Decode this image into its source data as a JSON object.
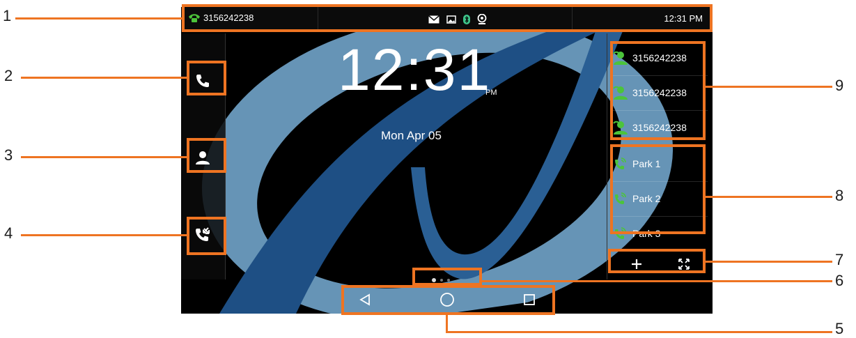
{
  "status_bar": {
    "line_number": "3156242238",
    "time": "12:31 PM",
    "icons": [
      "message-icon",
      "image-icon",
      "bluetooth-icon",
      "camera-icon"
    ]
  },
  "left_dock": {
    "items": [
      {
        "name": "phone-icon"
      },
      {
        "name": "contacts-icon"
      },
      {
        "name": "call-transfer-icon"
      }
    ]
  },
  "clock": {
    "time": "12:31",
    "ampm": "PM",
    "date": "Mon Apr 05"
  },
  "right_panel": {
    "lines": [
      {
        "label": "3156242238"
      },
      {
        "label": "3156242238"
      },
      {
        "label": "3156242238"
      }
    ],
    "parks": [
      {
        "label": "Park 1"
      },
      {
        "label": "Park 2"
      },
      {
        "label": "Park 3"
      }
    ],
    "bottom_buttons": [
      "add-icon",
      "expand-icon"
    ]
  },
  "pager": {
    "count": 3,
    "active": 1
  },
  "nav_bar": {
    "buttons": [
      "back-icon",
      "home-icon",
      "recents-icon"
    ]
  },
  "callouts": [
    "1",
    "2",
    "3",
    "4",
    "5",
    "6",
    "7",
    "8",
    "9"
  ],
  "colors": {
    "accent": "#ee7422",
    "line_green": "#4cc43a",
    "wallpaper_blue": "#5b8fb5"
  }
}
